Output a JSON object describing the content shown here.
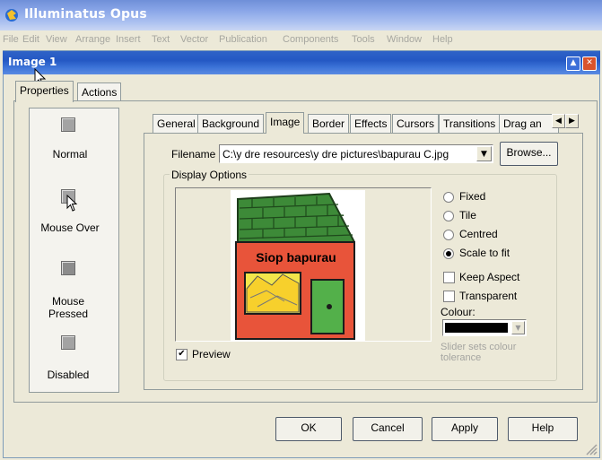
{
  "app": {
    "title": "Illuminatus Opus"
  },
  "menubar": [
    "File",
    "Edit",
    "View",
    "Arrange",
    "Insert",
    "Text",
    "Vector",
    "Publication",
    "Components",
    "Tools",
    "Window",
    "Help"
  ],
  "dialog": {
    "title": "Image 1",
    "outer_tabs": [
      "Properties",
      "Actions"
    ],
    "states": [
      "Normal",
      "Mouse Over",
      "Mouse Pressed",
      "Disabled"
    ],
    "inner_tabs": [
      "General",
      "Background",
      "Image",
      "Border",
      "Effects",
      "Cursors",
      "Transitions",
      "Drag an"
    ],
    "active_inner_tab": "Image",
    "filename_label": "Filename",
    "filename_value": "C:\\y dre resources\\y dre pictures\\bapurau C.jpg",
    "browse_label": "Browse...",
    "display_options_label": "Display Options",
    "preview_image_text": "Siop bapurau",
    "radio_options": [
      "Fixed",
      "Tile",
      "Centred",
      "Scale to fit"
    ],
    "radio_selected": "Scale to fit",
    "keep_aspect_label": "Keep Aspect",
    "transparent_label": "Transparent",
    "colour_label": "Colour:",
    "colour_value": "#000000",
    "slider_hint": "Slider sets colour tolerance",
    "preview_label": "Preview",
    "preview_checked": true,
    "buttons": {
      "ok": "OK",
      "cancel": "Cancel",
      "apply": "Apply",
      "help": "Help"
    }
  },
  "colors": {
    "app_title_bar": "#8aa6e8",
    "dialog_title_bar": "#2458c4",
    "dialog_bg": "#ece9d8",
    "shop_wall": "#e8543a",
    "shop_roof": "#3f8a3a",
    "shop_door": "#53b04a"
  }
}
